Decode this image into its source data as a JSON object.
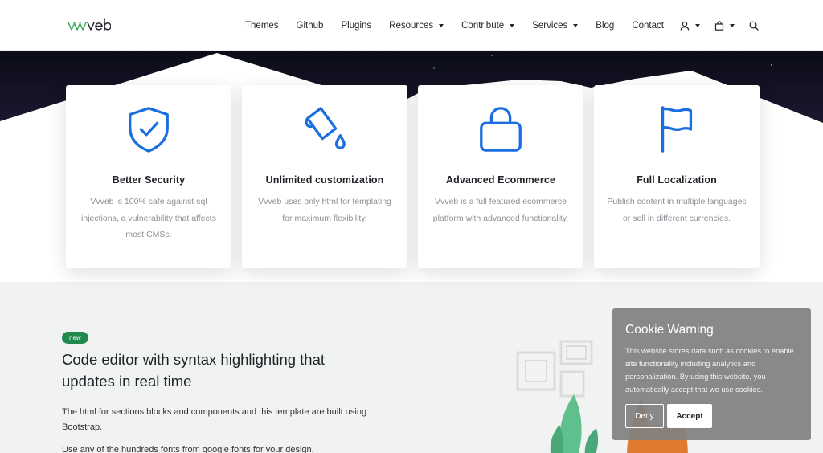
{
  "brand": {
    "logo_text": "vvveb",
    "accent": "#1a6fe0",
    "logo_green": "#3bab5a"
  },
  "nav": {
    "items": [
      {
        "label": "Themes",
        "dropdown": false
      },
      {
        "label": "Github",
        "dropdown": false
      },
      {
        "label": "Plugins",
        "dropdown": false
      },
      {
        "label": "Resources",
        "dropdown": true
      },
      {
        "label": "Contribute",
        "dropdown": true
      },
      {
        "label": "Services",
        "dropdown": true
      },
      {
        "label": "Blog",
        "dropdown": false
      },
      {
        "label": "Contact",
        "dropdown": false
      }
    ],
    "icons": [
      "user-icon",
      "cart-icon",
      "search-icon"
    ]
  },
  "features": [
    {
      "icon": "shield-check-icon",
      "title": "Better Security",
      "text": "Vvveb is 100% safe against sql injections, a vulnerability that affects most CMSs."
    },
    {
      "icon": "paint-bucket-icon",
      "title": "Unlimited customization",
      "text": "Vvveb uses only html for templating for maximum flexibility."
    },
    {
      "icon": "shopping-bag-icon",
      "title": "Advanced Ecommerce",
      "text": "Vvveb is a full featured ecommerce platform with advanced functionality."
    },
    {
      "icon": "flag-icon",
      "title": "Full Localization",
      "text": "Publish content in multiple languages or sell in different currencies."
    }
  ],
  "section2": {
    "badge": "new",
    "title": "Code editor with syntax highlighting that updates in real time",
    "paragraph1": "The html for sections blocks and components and this template are built using Bootstrap.",
    "paragraph2": "Use any of the hundreds fonts from google fonts for your design."
  },
  "cookie": {
    "title": "Cookie Warning",
    "text": "This website stores data such as cookies to enable site functionality including analytics and personalization. By using this website, you automatically accept that we use cookies.",
    "deny_label": "Deny",
    "accept_label": "Accept"
  }
}
